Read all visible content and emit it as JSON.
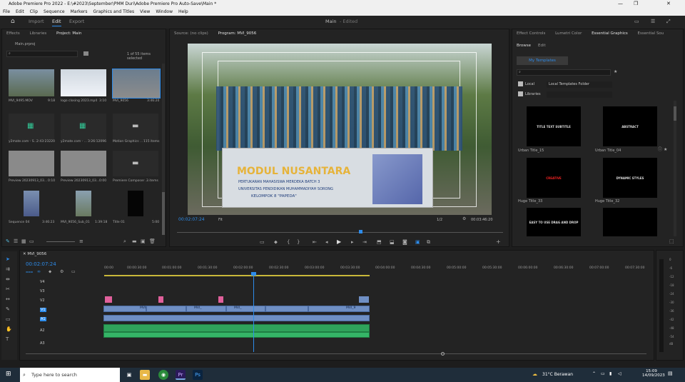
{
  "window": {
    "title": "Adobe Premiere Pro 2022 - E:\\#2023\\September\\PMM Duri\\Adobe Premiere Pro Auto-Save\\Main *",
    "minimize": "—",
    "maximize": "❐",
    "close": "✕"
  },
  "menu": [
    "File",
    "Edit",
    "Clip",
    "Sequence",
    "Markers",
    "Graphics and Titles",
    "View",
    "Window",
    "Help"
  ],
  "workspaces": {
    "import": "Import",
    "edit": "Edit",
    "export": "Export",
    "doc_title": "Main",
    "doc_state": "- Edited"
  },
  "project_panel": {
    "tabs": [
      "Effects",
      "Libraries",
      "Project: Main"
    ],
    "file": "Main.prproj",
    "item_count": "1 of 55 items selected",
    "items": [
      {
        "name": "MVI_9495.MOV",
        "dur": "9:18"
      },
      {
        "name": "logo closing 2023.mp4",
        "dur": "3:10"
      },
      {
        "name": "MVI_9056",
        "dur": "3:46:20"
      },
      {
        "name": "y2mate.com - S...",
        "dur": "2:43:23220"
      },
      {
        "name": "y2mate.com - ...",
        "dur": "3:26:12096"
      },
      {
        "name": "Motion Graphics ...",
        "dur": "115 items"
      },
      {
        "name": "Preview 20230913_03...",
        "dur": "0:10"
      },
      {
        "name": "Preview 20230913_03...",
        "dur": "0:00"
      },
      {
        "name": "Premiere Composer ...",
        "dur": "3 items"
      },
      {
        "name": "Sequence 04",
        "dur": "3:46:23"
      },
      {
        "name": "MVI_9056_Sub_01",
        "dur": "1:39:18"
      },
      {
        "name": "Title 01",
        "dur": "5:00"
      }
    ]
  },
  "program_monitor": {
    "tabs": [
      "Source: (no clips)",
      "Program: MVI_9056"
    ],
    "timecode": "00:02:07:24",
    "zoom": "Fit",
    "resolution": "1/2",
    "duration": "00:03:46:20",
    "banner_text": "MODUL NUSANTARA",
    "banner_sub1": "PERTUKARAN MAHASISWA MERDEKA BATCH 3",
    "banner_sub2": "UNIVERSITAS PENDIDIKAN MUHAMMADIYAH SORONG",
    "banner_sub3": "KELOMPOK 8 \"PAPEDA\""
  },
  "essential_graphics": {
    "tabs": [
      "Effect Controls",
      "Lumetri Color",
      "Essential Graphics",
      "Essential Sou"
    ],
    "subtabs": [
      "Browse",
      "Edit"
    ],
    "my_templates": "My Templates",
    "local_label": "Local",
    "local_folder": "Local Templates Folder",
    "libraries_label": "Libraries",
    "templates": [
      {
        "name": "Urban Title_15",
        "preview": "TITLE TEXT SUBTITLE"
      },
      {
        "name": "Urban Title_04",
        "preview": "ABSTRACT"
      },
      {
        "name": "Huge Title_33",
        "preview": "CREATIVE"
      },
      {
        "name": "Huge Title_32",
        "preview": "DYNAMIC STYLES"
      },
      {
        "name": "",
        "preview": "EASY TO USE DRAG AND DROP"
      },
      {
        "name": "",
        "preview": ""
      }
    ]
  },
  "timeline": {
    "sequence_tab": "MVI_9056",
    "timecode": "00:02:07:24",
    "ruler": [
      "00:00",
      "00:00:30:00",
      "00:01:00:00",
      "00:01:30:00",
      "00:02:00:00",
      "00:02:30:00",
      "00:03:00:00",
      "00:03:30:00",
      "00:04:00:00",
      "00:04:30:00",
      "00:05:00:00",
      "00:05:30:00",
      "00:06:00:00",
      "00:06:30:00",
      "00:07:00:00",
      "00:07:30:00"
    ],
    "tracks": [
      "V4",
      "V3",
      "V2",
      "V1",
      "A1",
      "A2",
      "A3"
    ],
    "clip_labels": [
      "MVI",
      "MVI_",
      "MVI_",
      "MVI_9"
    ],
    "meter_scale": [
      "0",
      "-6",
      "-12",
      "-18",
      "-24",
      "-30",
      "-36",
      "-42",
      "-48",
      "-54",
      "dB"
    ]
  },
  "taskbar": {
    "search_placeholder": "Type here to search",
    "weather": "31°C Berawan",
    "time": "15:09",
    "date": "14/09/2023"
  }
}
